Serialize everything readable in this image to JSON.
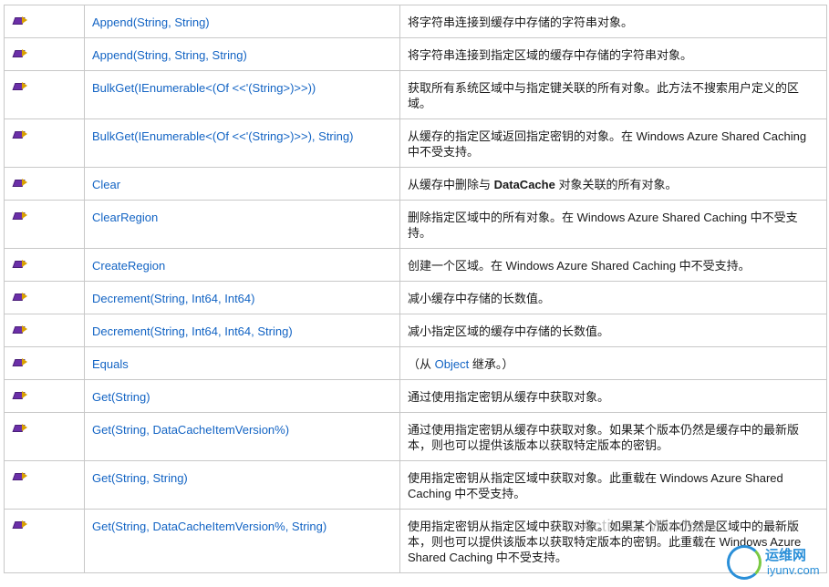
{
  "rows": [
    {
      "name": "Append(String, String)",
      "desc": "将字符串连接到缓存中存储的字符串对象。"
    },
    {
      "name": "Append(String, String, String)",
      "desc": "将字符串连接到指定区域的缓存中存储的字符串对象。"
    },
    {
      "name": "BulkGet(IEnumerable<(Of <<'(String>)>>))",
      "desc": "获取所有系统区域中与指定键关联的所有对象。此方法不搜索用户定义的区域。"
    },
    {
      "name": "BulkGet(IEnumerable<(Of <<'(String>)>>), String)",
      "desc": "从缓存的指定区域返回指定密钥的对象。在 Windows Azure Shared Caching 中不受支持。"
    },
    {
      "name": "Clear",
      "desc_pre": "从缓存中删除与 ",
      "desc_bold": "DataCache",
      "desc_post": " 对象关联的所有对象。"
    },
    {
      "name": "ClearRegion",
      "desc": "删除指定区域中的所有对象。在 Windows Azure Shared Caching 中不受支持。"
    },
    {
      "name": "CreateRegion",
      "desc": "创建一个区域。在 Windows Azure Shared Caching 中不受支持。"
    },
    {
      "name": "Decrement(String, Int64, Int64)",
      "desc": "减小缓存中存储的长数值。"
    },
    {
      "name": "Decrement(String, Int64, Int64, String)",
      "desc": "减小指定区域的缓存中存储的长数值。"
    },
    {
      "name": "Equals",
      "desc_pre": "（从 ",
      "desc_link": "Object",
      "desc_post": " 继承。）"
    },
    {
      "name": "Get(String)",
      "desc": "通过使用指定密钥从缓存中获取对象。"
    },
    {
      "name": "Get(String, DataCacheItemVersion%)",
      "desc": "通过使用指定密钥从缓存中获取对象。如果某个版本仍然是缓存中的最新版本，则也可以提供该版本以获取特定版本的密钥。"
    },
    {
      "name": "Get(String, String)",
      "desc": "使用指定密钥从指定区域中获取对象。此重载在 Windows Azure Shared Caching 中不受支持。"
    },
    {
      "name": "Get(String, DataCacheItemVersion%, String)",
      "desc": "使用指定密钥从指定区域中获取对象。如果某个版本仍然是区域中的最新版本，则也可以提供该版本以获取特定版本的密钥。此重载在 Windows Azure Shared Caching 中不受支持。"
    }
  ],
  "icon": "public-method-icon",
  "watermark": "Activate Windows",
  "logo": {
    "line1": "运维网",
    "line2": "iyunv.com"
  },
  "colors": {
    "link": "#1364c4",
    "border": "#c8c8c8"
  }
}
